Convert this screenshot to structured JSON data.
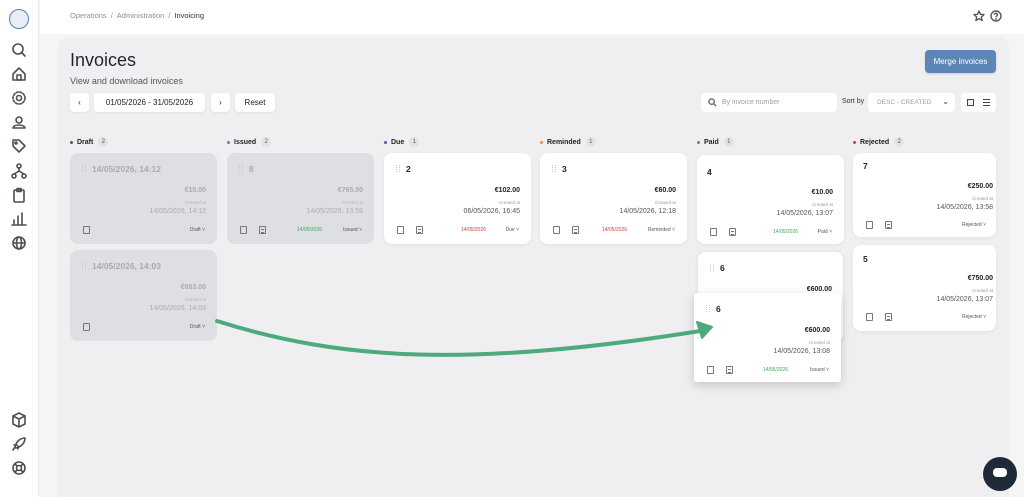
{
  "breadcrumb": [
    "Operations",
    "Administration",
    "Invoicing"
  ],
  "page": {
    "title": "Invoices",
    "subtitle": "View and download invoices",
    "merge_label": "Merge invoices"
  },
  "filters": {
    "prev": "‹",
    "next": "›",
    "date_range": "01/05/2026 - 31/05/2026",
    "reset_label": "Reset",
    "search_placeholder": "By invoice number",
    "sort_label": "Sort by",
    "sort_value": "DESC - CREATED"
  },
  "created_label": "Created at",
  "columns": [
    {
      "name": "Draft",
      "count": "2",
      "color": "#555555"
    },
    {
      "name": "Issued",
      "count": "2",
      "color": "#5b86b6"
    },
    {
      "name": "Due",
      "count": "1",
      "color": "#7b3fb5"
    },
    {
      "name": "Reminded",
      "count": "1",
      "color": "#e8923a"
    },
    {
      "name": "Paid",
      "count": "1",
      "color": "#3fa35a"
    },
    {
      "name": "Rejected",
      "count": "2",
      "color": "#d83a3a"
    }
  ],
  "cards": [
    {
      "id": "14/05/2026, 14:12",
      "amount": "€15.00",
      "created": "14/05/2026, 14:12",
      "due": "",
      "status": "Draft ˅"
    },
    {
      "id": "14/05/2026, 14:03",
      "amount": "€683.00",
      "created": "14/05/2026, 14:03",
      "due": "",
      "status": "Draft ˅"
    },
    {
      "id": "8",
      "amount": "€765.00",
      "created": "14/05/2026, 13:59",
      "due": "14/05/2026",
      "status": "Issued ˅"
    },
    {
      "id": "2",
      "amount": "€102.00",
      "created": "06/05/2026, 16:45",
      "due": "14/05/2026",
      "status": "Due ˅"
    },
    {
      "id": "3",
      "amount": "€60.00",
      "created": "14/05/2026, 12:18",
      "due": "14/05/2026",
      "status": "Reminded ˅"
    },
    {
      "id": "4",
      "amount": "€10.00",
      "created": "14/05/2026, 13:07",
      "due": "14/05/2026",
      "status": "Paid ˅"
    },
    {
      "id": "6",
      "amount": "€600.00"
    },
    {
      "id": "6",
      "amount": "€600.00",
      "created": "14/05/2026, 13:08",
      "due": "14/05/2026",
      "status": "Issued ˅"
    },
    {
      "id": "7",
      "amount": "€250.00",
      "created": "14/05/2026, 13:58",
      "status": "Rejected ˅"
    },
    {
      "id": "5",
      "amount": "€750.00",
      "created": "14/05/2026, 13:07",
      "status": "Rejected ˅"
    }
  ],
  "colors": {
    "accent": "#5b86b6",
    "drag_arrow": "#4daa7d",
    "due_red": "#d83a3a",
    "paid_green": "#3fa35a"
  },
  "icons": [
    "search-icon",
    "home-icon",
    "gear-icon",
    "user-tag-icon",
    "tag-icon",
    "network-icon",
    "clipboard-icon",
    "chart-icon",
    "globe-icon",
    "box-icon",
    "rocket-icon",
    "lifebuoy-icon",
    "star-icon",
    "help-icon",
    "chat-icon"
  ]
}
